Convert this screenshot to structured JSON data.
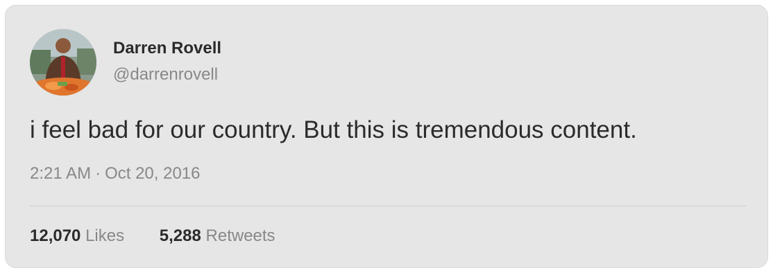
{
  "tweet": {
    "author_name": "Darren Rovell",
    "author_handle": "@darrenrovell",
    "avatar_icon": "user-avatar-photo",
    "text": "i feel bad for our country. But this is tremendous content.",
    "time": "2:21 AM",
    "separator": "·",
    "date": "Oct 20, 2016",
    "likes_count": "12,070",
    "likes_label": "Likes",
    "retweets_count": "5,288",
    "retweets_label": "Retweets"
  },
  "colors": {
    "card_background": "#e6e6e6",
    "primary_text": "#2b2b2b",
    "secondary_text": "#888888"
  }
}
